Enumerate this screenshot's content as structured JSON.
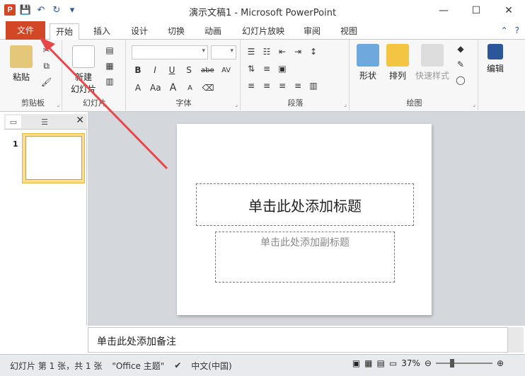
{
  "window": {
    "title": "演示文稿1 - Microsoft PowerPoint",
    "logo": "P",
    "controls": [
      "—",
      "☐",
      "✕"
    ]
  },
  "qat": {
    "icons": [
      "save-icon",
      "undo-icon",
      "redo-icon",
      "customize-icon"
    ]
  },
  "tabs": {
    "file": "文件",
    "items": [
      "开始",
      "插入",
      "设计",
      "切换",
      "动画",
      "幻灯片放映",
      "审阅",
      "视图"
    ]
  },
  "ribbon": {
    "clipboard": {
      "paste": "粘贴",
      "label": "剪贴板"
    },
    "slides": {
      "new": "新建",
      "new2": "幻灯片",
      "label": "幻灯片"
    },
    "font": {
      "label": "字体",
      "row1": [
        "B",
        "I",
        "U",
        "S",
        "abe",
        "AV"
      ],
      "row2": [
        "A",
        "Aa",
        "A",
        "A"
      ]
    },
    "paragraph": {
      "label": "段落"
    },
    "drawing": {
      "shapes": "形状",
      "arrange": "排列",
      "quickstyles": "快速样式",
      "label": "绘图"
    },
    "editing": {
      "label": "编辑"
    }
  },
  "pane": {
    "slide_number": "1"
  },
  "slide": {
    "title_placeholder": "单击此处添加标题",
    "subtitle_placeholder": "单击此处添加副标题"
  },
  "notes": {
    "placeholder": "单击此处添加备注"
  },
  "status": {
    "slide_info": "幻灯片 第 1 张，共 1 张",
    "theme": "\"Office 主题\"",
    "language": "中文(中国)",
    "zoom": "37%"
  },
  "colors": {
    "file_tab": "#d24726",
    "accent": "#2b579a",
    "annotation_arrow": "#e8474a"
  }
}
